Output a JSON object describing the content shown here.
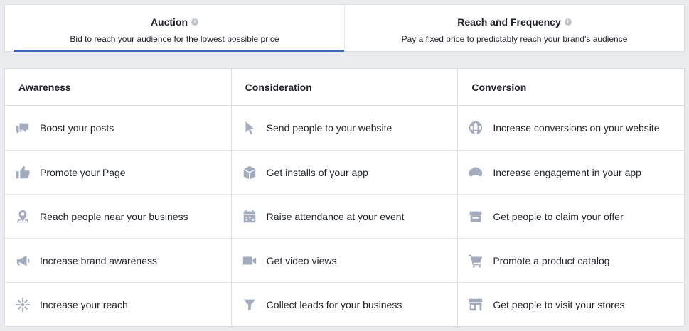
{
  "tabs": [
    {
      "title": "Auction",
      "subtitle": "Bid to reach your audience for the lowest possible price",
      "active": true
    },
    {
      "title": "Reach and Frequency",
      "subtitle": "Pay a fixed price to predictably reach your brand's audience",
      "active": false
    }
  ],
  "info_glyph": "i",
  "columns": [
    {
      "header": "Awareness",
      "items": [
        {
          "label": "Boost your posts",
          "icon": "speech-bubbles-icon"
        },
        {
          "label": "Promote your Page",
          "icon": "thumbs-up-icon"
        },
        {
          "label": "Reach people near your business",
          "icon": "map-pin-icon"
        },
        {
          "label": "Increase brand awareness",
          "icon": "megaphone-icon"
        },
        {
          "label": "Increase your reach",
          "icon": "snowflake-burst-icon"
        }
      ]
    },
    {
      "header": "Consideration",
      "items": [
        {
          "label": "Send people to your website",
          "icon": "cursor-icon"
        },
        {
          "label": "Get installs of your app",
          "icon": "box-icon"
        },
        {
          "label": "Raise attendance at your event",
          "icon": "calendar-icon"
        },
        {
          "label": "Get video views",
          "icon": "video-camera-icon"
        },
        {
          "label": "Collect leads for your business",
          "icon": "funnel-icon"
        }
      ]
    },
    {
      "header": "Conversion",
      "items": [
        {
          "label": "Increase conversions on your website",
          "icon": "globe-icon"
        },
        {
          "label": "Increase engagement in your app",
          "icon": "gamepad-icon"
        },
        {
          "label": "Get people to claim your offer",
          "icon": "offer-tag-icon"
        },
        {
          "label": "Promote a product catalog",
          "icon": "shopping-cart-icon"
        },
        {
          "label": "Get people to visit your stores",
          "icon": "storefront-icon"
        }
      ]
    }
  ],
  "colors": {
    "accent": "#4267b2",
    "icon": "#a3abbf",
    "border": "#dddfe2",
    "background": "#e9ebee"
  }
}
